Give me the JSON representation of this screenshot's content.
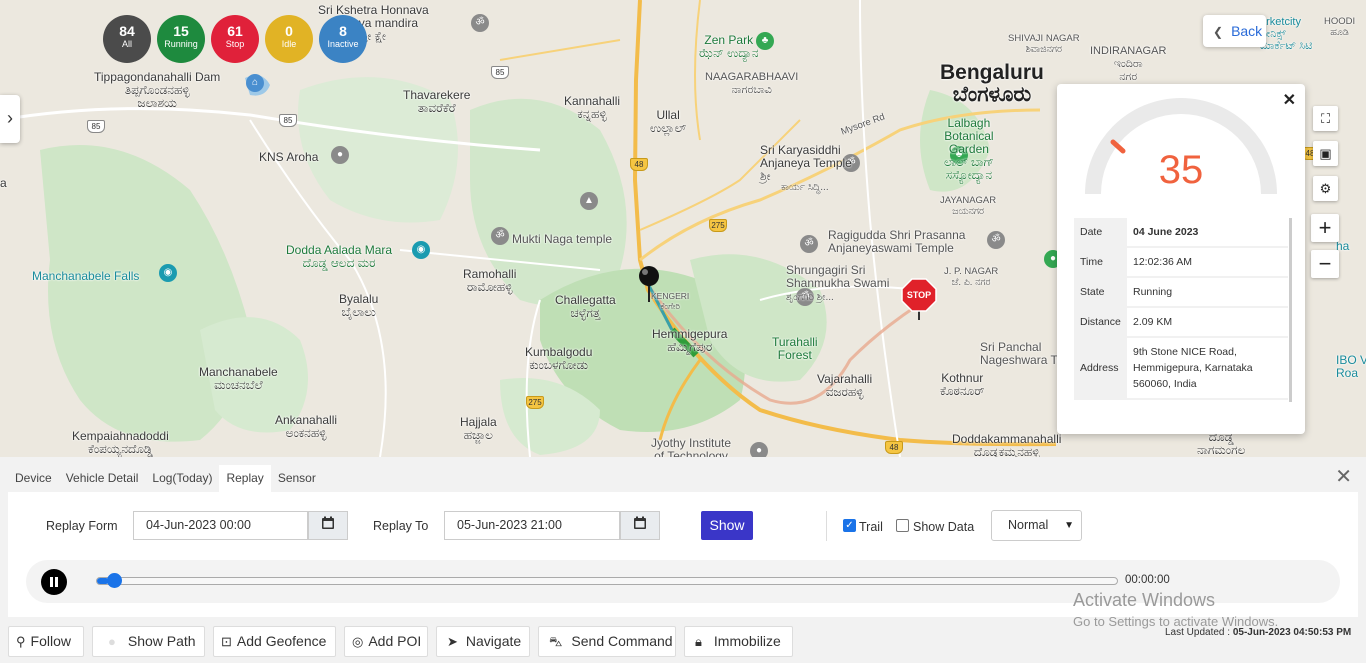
{
  "status": [
    {
      "count": "84",
      "label": "All",
      "color": "#4b4b4b"
    },
    {
      "count": "15",
      "label": "Running",
      "color": "#1e8a3e"
    },
    {
      "count": "61",
      "label": "Stop",
      "color": "#e0213a"
    },
    {
      "count": "0",
      "label": "Idle",
      "color": "#e1b325"
    },
    {
      "count": "8",
      "label": "Inactive",
      "color": "#3b83c4"
    }
  ],
  "map": {
    "back_label": "Back",
    "labels": {
      "kshetra": "Sri Kshetra Honnava",
      "kshetra2": "ntralaya mandira",
      "kshetra3": "ಶ್ರೀ ಕ್ಷೇ",
      "tippa": "Tippagondanahalli Dam",
      "tippa_kn": "ತಿಪ್ಪಗೊಂಡನಹಳ್ಳಿ",
      "tippa_kn2": "ಜಲಾಶಯ",
      "thavarekere": "Thavarekere",
      "thavarekere_kn": "ತಾವರೆಕೆರೆ",
      "kannahalli": "Kannahalli",
      "kannahalli_kn": "ಕನ್ನಹಳ್ಳಿ",
      "ullal": "Ullal",
      "ullal_kn": "ಉಲ್ಲಾಲ್",
      "zenpark": "Zen Park",
      "zenpark_kn": "ಝೆನ್ ಉದ್ಯಾನ",
      "nagarabhaavi": "NAAGARABHAAVI",
      "nagarabhaavi_kn": "ನಾಗರಬಾವಿ",
      "bengaluru": "Bengaluru",
      "bengaluru_kn": "ಬೆಂಗಳೂರು",
      "shivaji": "SHIVAJI NAGAR",
      "shivaji_kn": "ಶಿವಾಜಿನಗರ",
      "indira": "INDIRANAGAR",
      "indira_kn": "ಇಂದಿರಾ",
      "indira_kn2": "ನಗರ",
      "marketcity": "arketcity",
      "marketcity2": "ಫೀನಿಕ್ಸ್",
      "marketcity3": "ಮಾರ್ಕೆಟ್ ಸಿಟಿ",
      "hoodi": "HOODI",
      "hoodi_kn": "ಹೂಡಿ",
      "kns": "KNS Aroha",
      "lalbagh": "Lalbagh",
      "lalbagh2": "Botanical",
      "lalbagh3": "Garden",
      "lalbagh_kn": "ಲಾಲ್ ಬಾಗ್",
      "lalbagh_kn2": "ಸಸ್ಯೋದ್ಯಾನ",
      "karya": "Sri Karyasiddhi",
      "karya2": "Anjaneya Temple",
      "karya_kn": "ಶ್ರೀ",
      "mysore": "Mysore Rd",
      "karya_kn2": "ಕಾರ್ಯ ಸಿದ್ಧಿ...",
      "jayanagar": "JAYANAGAR",
      "jayanagar_kn": "ಜಯನಗರ",
      "mukti": "Mukti Naga temple",
      "ragi": "Ragigudda Shri Prasanna",
      "ragi2": "Anjaneyaswami Temple",
      "dodda": "Dodda Aalada Mara",
      "dodda_kn": "ದೊಡ್ಡ ಆಲದ ಮರ",
      "manch_falls": "Manchanabele Falls",
      "ramohalli": "Ramohalli",
      "ramohalli_kn": "ರಾಮೋಹಳ್ಳಿ",
      "challegatta": "Challegatta",
      "challegatta_kn": "ಚಳ್ಳೆಗತ್ತ",
      "kengeri": "KENGERI",
      "kengeri_kn": "ಕೆಂಗೇರಿ",
      "shrungagiri": "Shrungagiri Sri",
      "shrungagiri2": "Shanmukha Swami",
      "shrungagiri_kn": "ಶೃಂಗಗಿರಿ ಶ್ರೀ...",
      "jpnagar": "J. P. NAGAR",
      "jpnagar_kn": "ಜೆ. ಪಿ. ನಗರ",
      "byalalu": "Byalalu",
      "byalalu_kn": "ಬೈಲಾಲು",
      "hemmigepura": "Hemmigepura",
      "hemmigepura_kn": "ಹೆಮ್ಮಿಗೆಪುರ",
      "turahalli": "Turahalli",
      "turahalli2": "Forest",
      "sripanchal": "Sri Panchal",
      "nageshwara": "Nageshwara Ten",
      "kumbalgodu": "Kumbalgodu",
      "kumbalgodu_kn": "ಕುಂಬಳಗೋಡು",
      "manchanabele": "Manchanabele",
      "manchanabele_kn": "ಮಂಚನಬೆಲೆ",
      "vajarahalli": "Vajarahalli",
      "vajarahalli_kn": "ವಜರಹಳ್ಳಿ",
      "kothnur": "Kothnur",
      "kothnur_kn": "ಕೊಠನೂರ್",
      "ibo": "IBO V",
      "ibo2": "Roa",
      "ankanahalli": "Ankanahalli",
      "ankanahalli_kn": "ಅಂಕನಹಳ್ಳಿ",
      "hajjala": "Hajjala",
      "hajjala_kn": "ಹಜ್ಜಾಲ",
      "kempaiah": "Kempaiahnadoddi",
      "kempaiah_kn": "ಕೆಂಪಯ್ಯನದೊಡ್ಡಿ",
      "jyothy": "Jyothy Institute",
      "jyothy2": "of Technology",
      "doddakam": "Doddakammanahalli",
      "doddakam_kn": "ದೊಡ್ಡಕಮ್ಮನಹಳ್ಳಿ",
      "nagamangala": "ದೊಡ್ಡ",
      "nagamangala2": "ನಾಗಮಂಗಲ",
      "edge_a": "a",
      "edge_ha": "ha",
      "stop_sign": "STOP"
    },
    "shields": {
      "s85a": "85",
      "s85b": "85",
      "s85c": "85",
      "s48a": "48",
      "s48b": "48",
      "s275a": "275",
      "s275b": "275",
      "s48c": "48"
    }
  },
  "popup": {
    "speed": "35",
    "rows": [
      {
        "key": "Date",
        "value": "04 June 2023"
      },
      {
        "key": "Time",
        "value": "12:02:36 AM"
      },
      {
        "key": "State",
        "value": "Running"
      },
      {
        "key": "Distance",
        "value": "2.09 KM"
      }
    ],
    "address_key": "Address",
    "address_line1": "9th Stone NICE Road,",
    "address_line2": "Hemmigepura, Karnataka",
    "address_line3": "560060, India",
    "gauge_color": "#f0623e"
  },
  "tabs": [
    "Device",
    "Vehicle Detail",
    "Log(Today)",
    "Replay",
    "Sensor"
  ],
  "replay": {
    "from_label": "Replay Form",
    "from_value": "04-Jun-2023 00:00",
    "to_label": "Replay To",
    "to_value": "05-Jun-2023 21:00",
    "show_label": "Show",
    "trail_label": "Trail",
    "trail_checked": true,
    "show_data_label": "Show Data",
    "show_data_checked": false,
    "speed_value": "Normal",
    "time": "00:00:00",
    "progress": 0.012
  },
  "actions": {
    "follow": "Follow",
    "show_path": "Show Path",
    "add_geofence": "Add Geofence",
    "add_poi": "Add POI",
    "navigate": "Navigate",
    "send_command": "Send Command",
    "immobilize": "Immobilize"
  },
  "watermark": {
    "line1": "Activate Windows",
    "line2": "Go to Settings to activate Windows."
  },
  "last_updated": {
    "label": "Last Updated :",
    "value": "05-Jun-2023 04:50:53 PM"
  }
}
